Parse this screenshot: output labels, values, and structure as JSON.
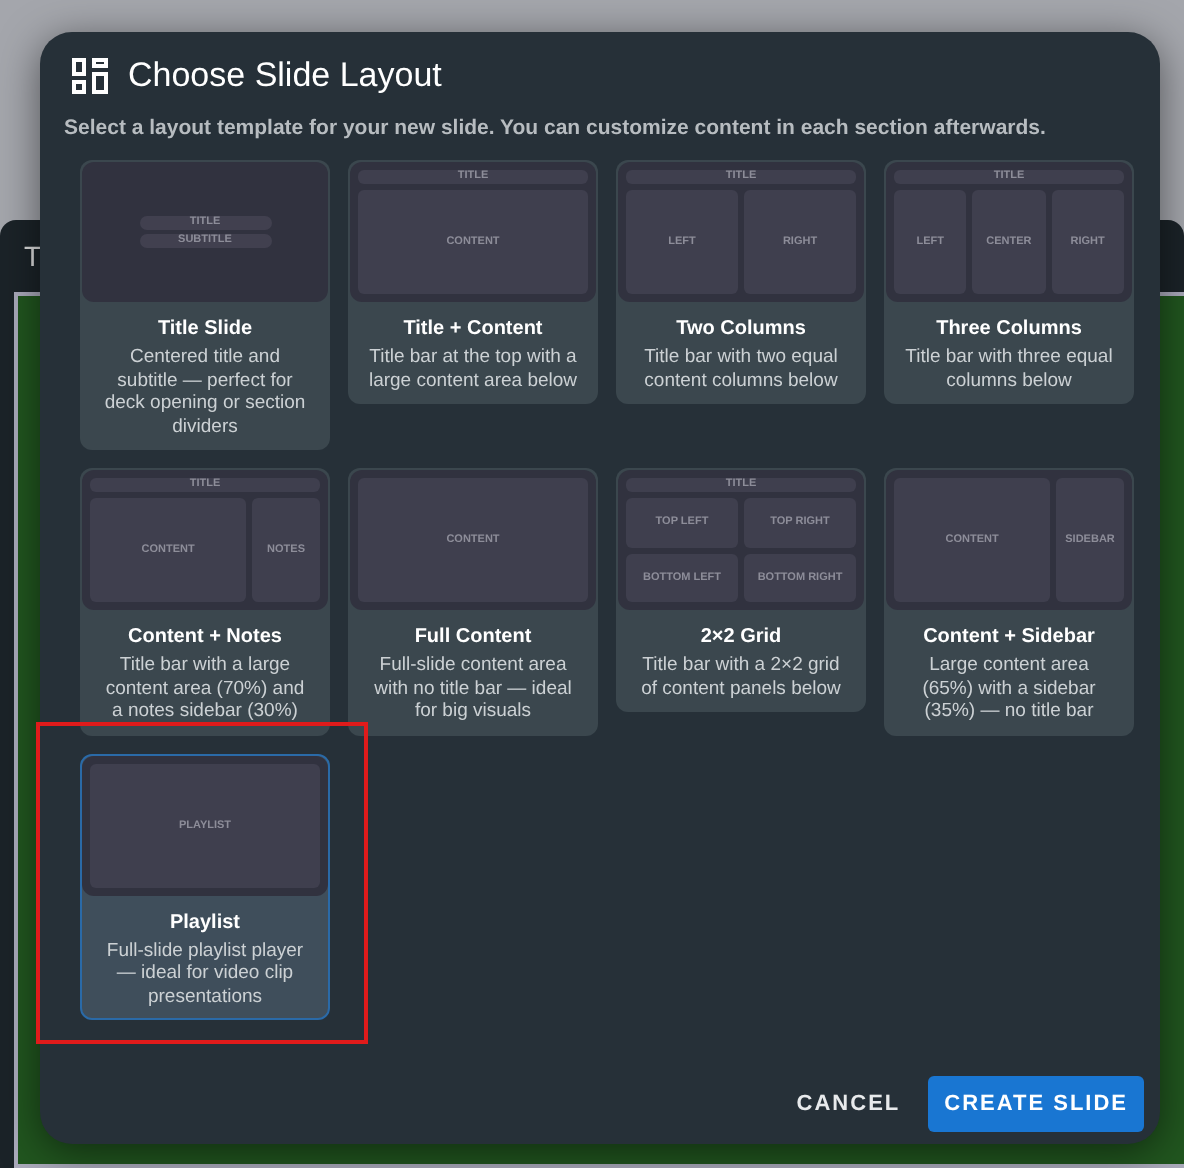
{
  "backdrop": {
    "title_fragment": "T"
  },
  "dialog": {
    "title": "Choose Slide Layout",
    "subtitle": "Select a layout template for your new slide. You can customize content in each section afterwards.",
    "layouts": [
      {
        "name": "Title Slide",
        "description": "Centered title and subtitle — perfect for deck opening or section dividers",
        "selected": false,
        "preview": {
          "kind": "centered",
          "panels": [
            {
              "label": "TITLE"
            },
            {
              "label": "SUBTITLE"
            }
          ]
        }
      },
      {
        "name": "Title + Content",
        "description": "Title bar at the top with a large content area below",
        "selected": false,
        "preview": {
          "kind": "columns",
          "title": "TITLE",
          "panels": [
            {
              "label": "CONTENT",
              "kind": "wide"
            }
          ]
        }
      },
      {
        "name": "Two Columns",
        "description": "Title bar with two equal content columns below",
        "selected": false,
        "preview": {
          "kind": "columns",
          "title": "TITLE",
          "panels": [
            {
              "label": "LEFT",
              "kind": "wide"
            },
            {
              "label": "RIGHT",
              "kind": "wide"
            }
          ]
        }
      },
      {
        "name": "Three Columns",
        "description": "Title bar with three equal columns below",
        "selected": false,
        "preview": {
          "kind": "columns",
          "title": "TITLE",
          "panels": [
            {
              "label": "LEFT",
              "kind": "wide"
            },
            {
              "label": "CENTER",
              "kind": "wide"
            },
            {
              "label": "RIGHT",
              "kind": "wide"
            }
          ]
        }
      },
      {
        "name": "Content + Notes",
        "description": "Title bar with a large content area (70%) and a notes sidebar (30%)",
        "selected": false,
        "preview": {
          "kind": "columns",
          "title": "TITLE",
          "panels": [
            {
              "label": "CONTENT",
              "kind": "wide"
            },
            {
              "label": "NOTES",
              "kind": "narrow"
            }
          ]
        }
      },
      {
        "name": "Full Content",
        "description": "Full-slide content area with no title bar — ideal for big visuals",
        "selected": false,
        "preview": {
          "kind": "columns",
          "panels": [
            {
              "label": "CONTENT",
              "kind": "wide"
            }
          ]
        }
      },
      {
        "name": "2×2 Grid",
        "description": "Title bar with a 2×2 grid of content panels below",
        "selected": false,
        "preview": {
          "kind": "grid",
          "title": "TITLE",
          "panels": [
            {
              "label": "TOP LEFT",
              "kind": "wide"
            },
            {
              "label": "TOP RIGHT",
              "kind": "wide"
            },
            {
              "label": "BOTTOM LEFT",
              "kind": "wide"
            },
            {
              "label": "BOTTOM RIGHT",
              "kind": "wide"
            }
          ]
        }
      },
      {
        "name": "Content + Sidebar",
        "description": "Large content area (65%) with a sidebar (35%) — no title bar",
        "selected": false,
        "preview": {
          "kind": "columns",
          "panels": [
            {
              "label": "CONTENT",
              "kind": "wide"
            },
            {
              "label": "SIDEBAR",
              "kind": "narrow"
            }
          ]
        }
      },
      {
        "name": "Playlist",
        "description": "Full-slide playlist player — ideal for video clip presentations",
        "selected": true,
        "highlighted": true,
        "preview": {
          "kind": "columns",
          "panels": [
            {
              "label": "PLAYLIST",
              "kind": "wide"
            }
          ]
        }
      }
    ],
    "buttons": [
      {
        "label": "CANCEL",
        "kind": "text"
      },
      {
        "label": "CREATE SLIDE",
        "kind": "primary"
      }
    ]
  }
}
